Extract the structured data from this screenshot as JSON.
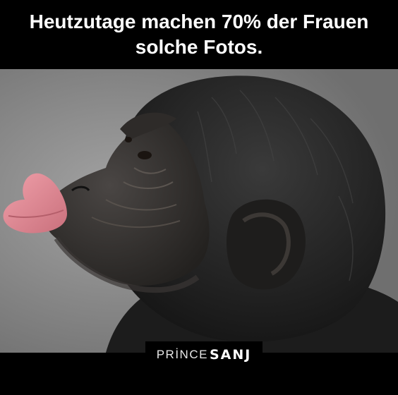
{
  "caption": {
    "line1": "Heutzutage machen 70% der Frauen",
    "line2": "solche Fotos."
  },
  "watermark": {
    "prefix": "PRİNCE",
    "suffix": "SANJ",
    "text_color": "#ffffff",
    "background": "#000000"
  },
  "photo": {
    "subject": "chimpanzee-pouting-lips",
    "background_color": "#8d8d8d",
    "fur_color": "#262626",
    "lip_color": "#e8909a"
  }
}
